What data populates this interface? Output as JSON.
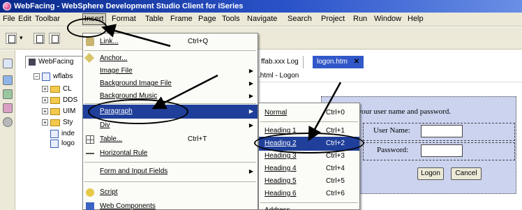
{
  "window": {
    "title": "WebFacing - WebSphere Development Studio Client for iSeries"
  },
  "menubar": {
    "items": [
      "File",
      "Edit",
      "Toolbar",
      "Insert",
      "Format",
      "Table",
      "Frame",
      "Page",
      "Tools",
      "Navigate",
      "Search",
      "Project",
      "Run",
      "Window",
      "Help"
    ]
  },
  "nav": {
    "tab": "WebFacing",
    "tree": [
      "wflabs",
      "CL",
      "DDS",
      "UIM",
      "Sty",
      "inde",
      "logo"
    ]
  },
  "editor": {
    "tabs": [
      {
        "label": "ffab.xxx Log"
      },
      {
        "label": "logon.htm"
      }
    ],
    "file_label": ".html - Logon",
    "form": {
      "prompt": "se type your user name and password.",
      "user_label": "User Name:",
      "password_label": "Password:",
      "logon_button": "Logon",
      "cancel_button": "Cancel"
    }
  },
  "insert_menu": {
    "items": [
      {
        "label": "Link...",
        "shortcut": "Ctrl+Q"
      },
      {
        "label": "Anchor..."
      },
      {
        "label": "Image File"
      },
      {
        "label": "Background Image File"
      },
      {
        "label": "Background Music"
      },
      {
        "label": "Paragraph"
      },
      {
        "label": "Div"
      },
      {
        "label": "Table...",
        "shortcut": "Ctrl+T"
      },
      {
        "label": "Horizontal Rule"
      },
      {
        "label": "Form and Input Fields"
      },
      {
        "label": "Script"
      },
      {
        "label": "Web Components"
      }
    ]
  },
  "paragraph_menu": {
    "items": [
      {
        "label": "Normal",
        "shortcut": "Ctrl+0"
      },
      {
        "label": "Heading 1",
        "shortcut": "Ctrl+1"
      },
      {
        "label": "Heading 2",
        "shortcut": "Ctrl+2"
      },
      {
        "label": "Heading 3",
        "shortcut": "Ctrl+3"
      },
      {
        "label": "Heading 4",
        "shortcut": "Ctrl+4"
      },
      {
        "label": "Heading 5",
        "shortcut": "Ctrl+5"
      },
      {
        "label": "Heading 6",
        "shortcut": "Ctrl+6"
      },
      {
        "label": "Address"
      }
    ]
  },
  "colors": {
    "title_gradient_start": "#0a2a8a",
    "menu_highlight": "#1f3f9a",
    "form_background": "#cbd3ef",
    "chrome": "#ece9d8"
  }
}
